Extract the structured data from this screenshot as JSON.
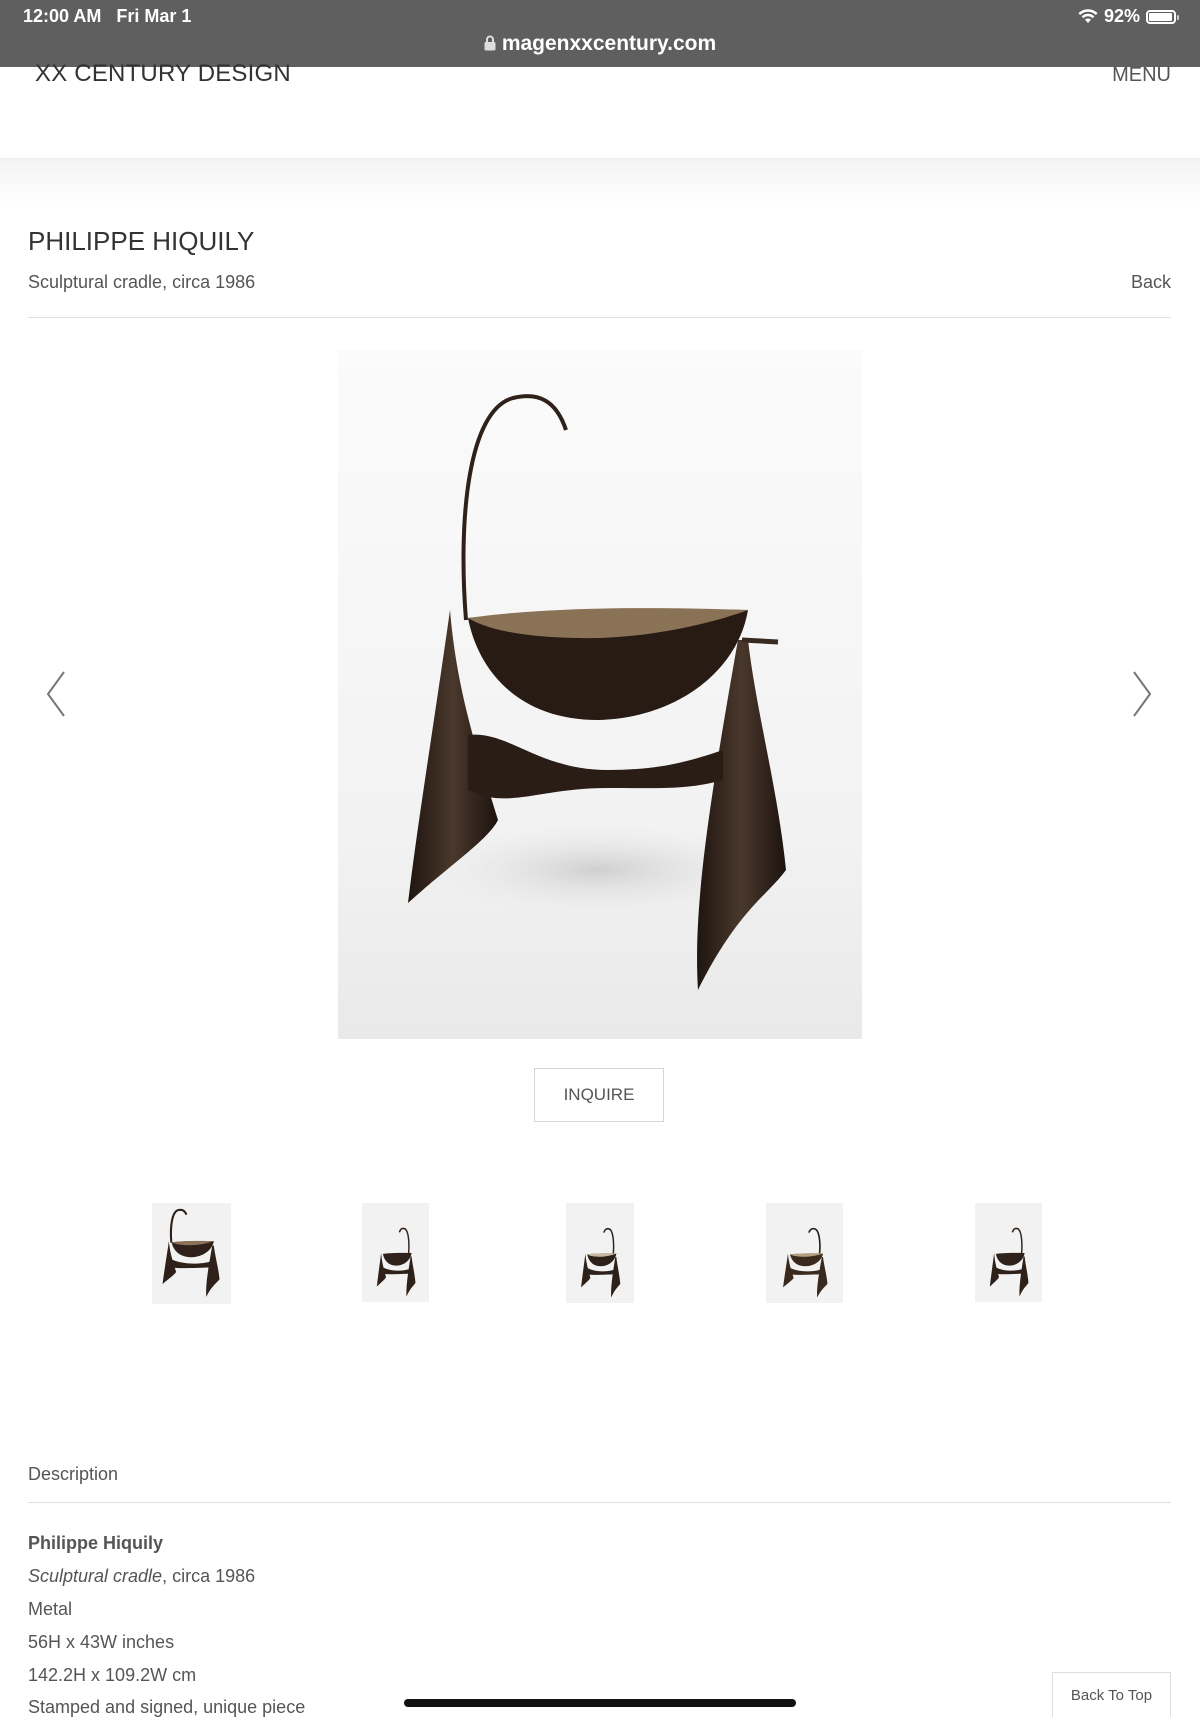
{
  "status_bar": {
    "time": "12:00 AM",
    "date": "Fri Mar 1",
    "battery_percent": "92%",
    "url": "magenxxcentury.com"
  },
  "header": {
    "site_title": "XX CENTURY DESIGN",
    "menu_label": "MENU"
  },
  "product": {
    "artist": "PHILIPPE HIQUILY",
    "subtitle": "Sculptural cradle, circa 1986",
    "back_label": "Back",
    "inquire_label": "INQUIRE",
    "thumbnail_count": 5
  },
  "description": {
    "heading": "Description",
    "artist": "Philippe Hiquily",
    "title_italic": "Sculptural cradle",
    "title_rest": ", circa 1986",
    "material": "Metal",
    "dims_in": "56H x 43W inches",
    "dims_cm": "142.2H x 109.2W cm",
    "notes": "Stamped and signed, unique piece"
  },
  "footer": {
    "back_to_top_label": "Back To Top"
  },
  "icons": [
    "lock-icon",
    "wifi-icon",
    "battery-icon",
    "chevron-left-icon",
    "chevron-right-icon"
  ],
  "colors": {
    "status_bar_bg": "#5f5f5f",
    "text": "#333333",
    "muted_text": "#555555",
    "divider": "#e0e0e0",
    "sculpture_bronze": "#2e2119"
  }
}
